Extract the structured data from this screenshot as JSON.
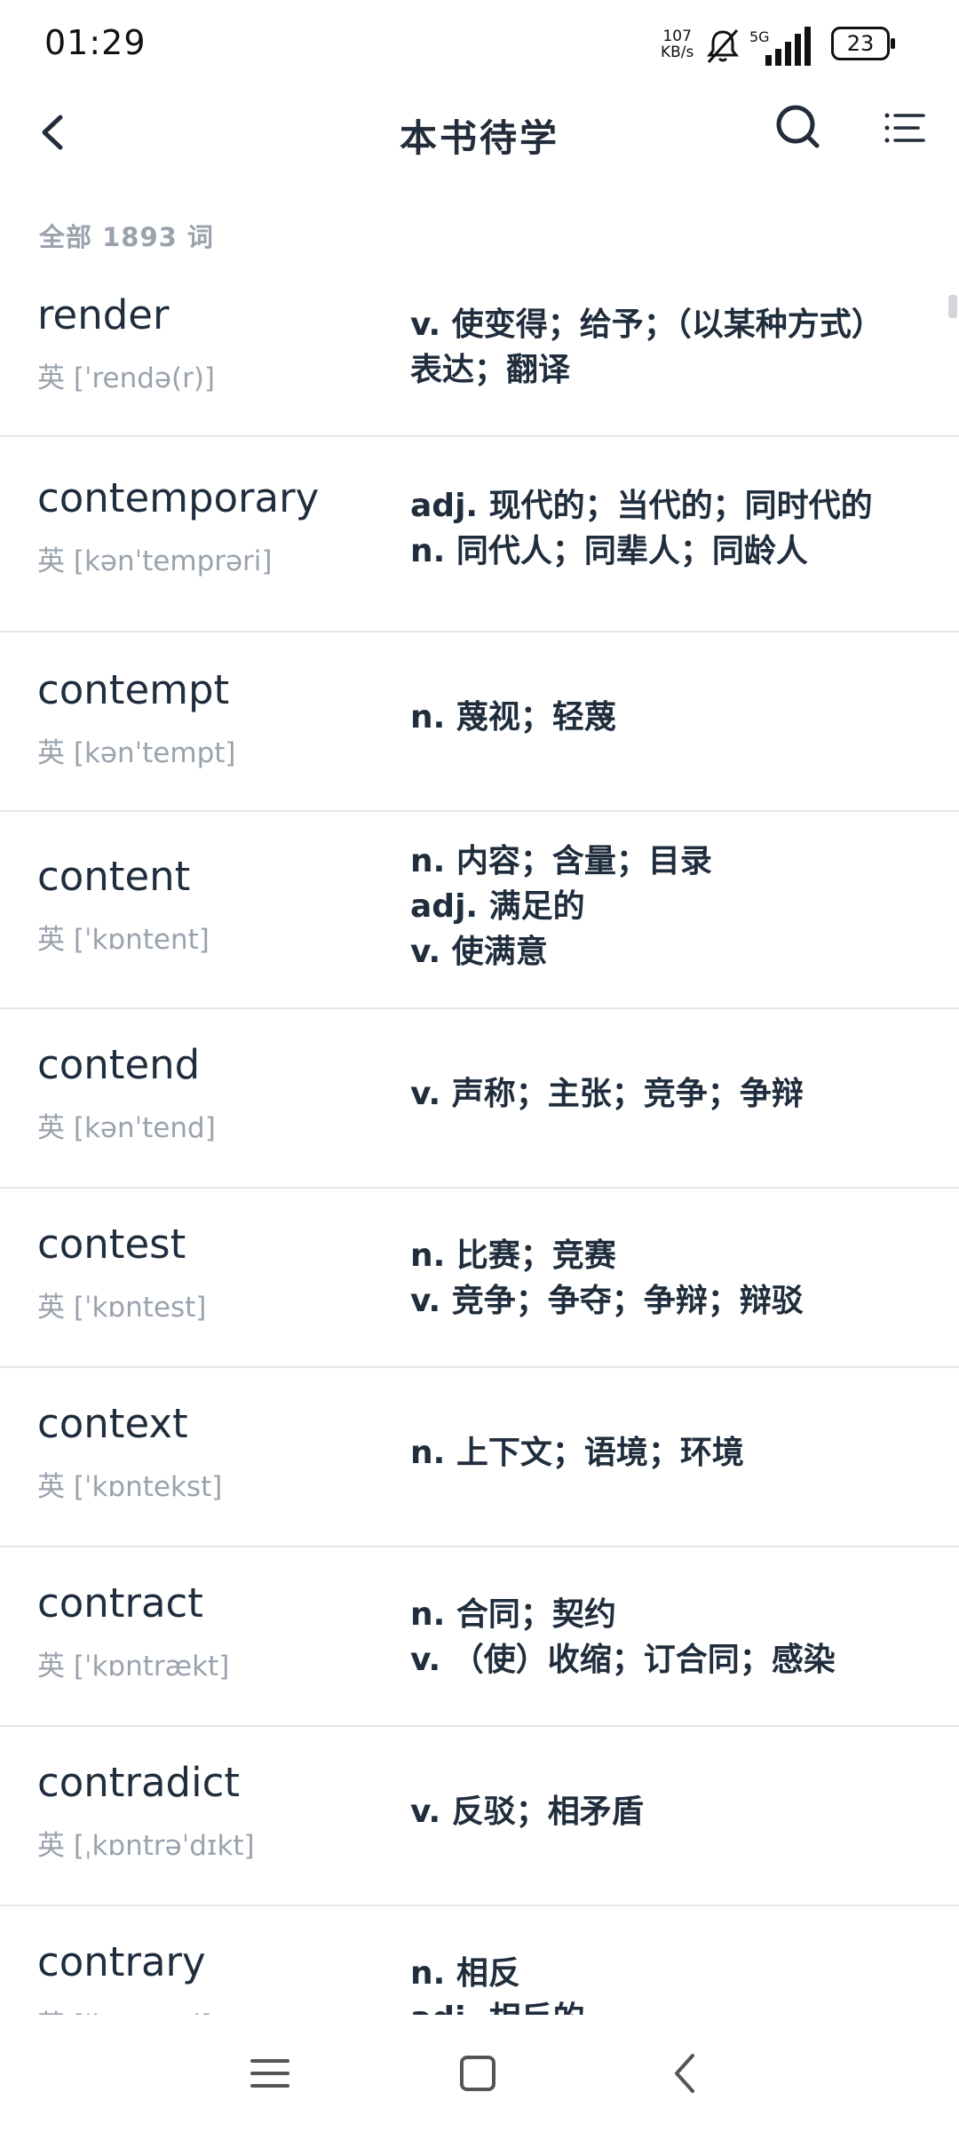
{
  "status": {
    "time": "01:29",
    "speed_value": "107",
    "speed_unit": "KB/s",
    "network": "5G",
    "battery": "23"
  },
  "header": {
    "title": "本书待学"
  },
  "summary": {
    "count_label": "全部 1893 词"
  },
  "words": [
    {
      "word": "render",
      "phonetic": "英 [ˈrendə(r)]",
      "defs": [
        "v. 使变得；给予；（以某种方式）表达；翻译"
      ]
    },
    {
      "word": "contemporary",
      "phonetic": "英 [kənˈtemprəri]",
      "defs": [
        "adj. 现代的；当代的；同时代的",
        "n. 同代人；同辈人；同龄人"
      ]
    },
    {
      "word": "contempt",
      "phonetic": "英 [kənˈtempt]",
      "defs": [
        "n. 蔑视；轻蔑"
      ]
    },
    {
      "word": "content",
      "phonetic": "英 [ˈkɒntent]",
      "defs": [
        "n. 内容；含量；目录",
        "adj. 满足的",
        "v. 使满意"
      ]
    },
    {
      "word": "contend",
      "phonetic": "英 [kənˈtend]",
      "defs": [
        "v. 声称；主张；竞争；争辩"
      ]
    },
    {
      "word": "contest",
      "phonetic": "英 [ˈkɒntest]",
      "defs": [
        "n. 比赛；竞赛",
        "v. 竞争；争夺；争辩；辩驳"
      ]
    },
    {
      "word": "context",
      "phonetic": "英 [ˈkɒntekst]",
      "defs": [
        "n. 上下文；语境；环境"
      ]
    },
    {
      "word": "contract",
      "phonetic": "英 [ˈkɒntrækt]",
      "defs": [
        "n. 合同；契约",
        "v. （使）收缩；订合同；感染"
      ]
    },
    {
      "word": "contradict",
      "phonetic": "英 [ˌkɒntrəˈdɪkt]",
      "defs": [
        "v. 反驳；相矛盾"
      ]
    },
    {
      "word": "contrary",
      "phonetic": "英 [ˈkɒntrəri]",
      "defs": [
        "n. 相反",
        "adj. 相反的"
      ]
    }
  ]
}
